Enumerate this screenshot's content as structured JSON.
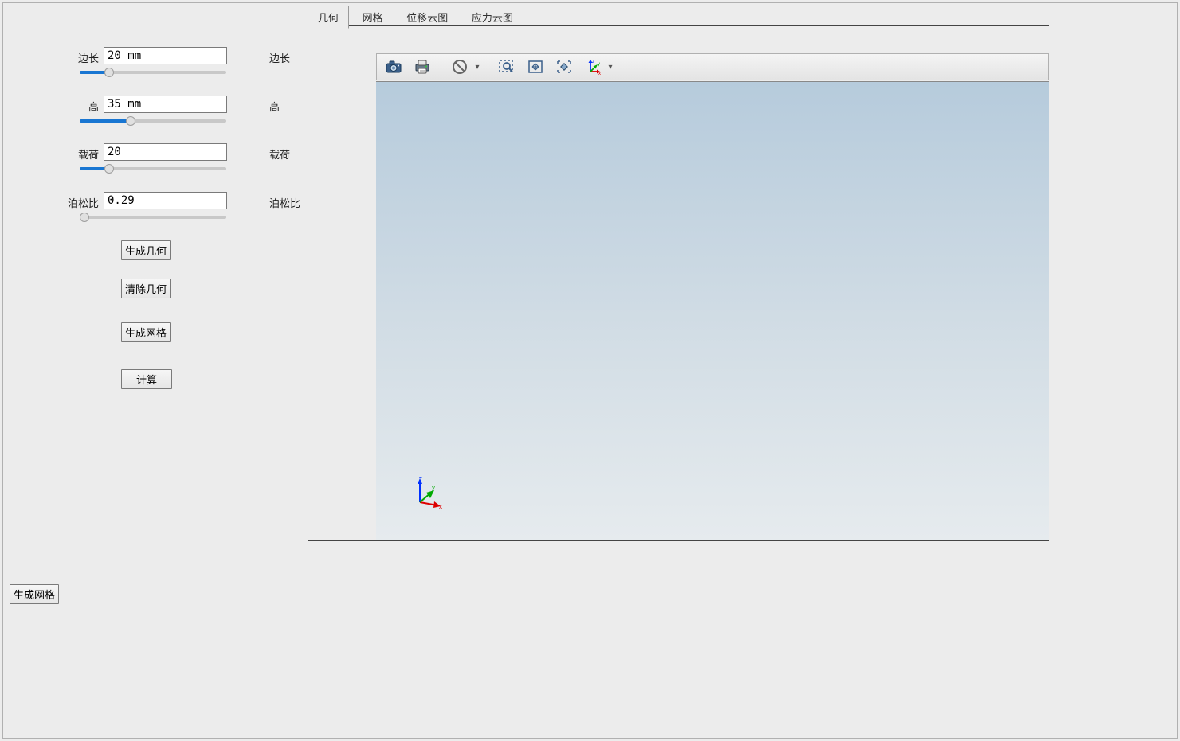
{
  "params": {
    "edge": {
      "label_left": "边长",
      "value": "20 mm",
      "label_right": "边长",
      "slider_pct": 20
    },
    "height": {
      "label_left": "高",
      "value": "35 mm",
      "label_right": "高",
      "slider_pct": 35
    },
    "load": {
      "label_left": "载荷",
      "value": "20",
      "label_right": "载荷",
      "slider_pct": 20
    },
    "poisson": {
      "label_left": "泊松比",
      "value": "0.29",
      "label_right": "泊松比",
      "slider_pct": 3
    }
  },
  "buttons": {
    "gen_geom": "生成几何",
    "clear_geom": "清除几何",
    "gen_mesh": "生成网格",
    "compute": "计算",
    "bottom_gen_mesh": "生成网格"
  },
  "tabs": {
    "geom": "几何",
    "mesh": "网格",
    "disp": "位移云图",
    "stress": "应力云图"
  },
  "triad": {
    "x": "x",
    "y": "y",
    "z": "z"
  }
}
